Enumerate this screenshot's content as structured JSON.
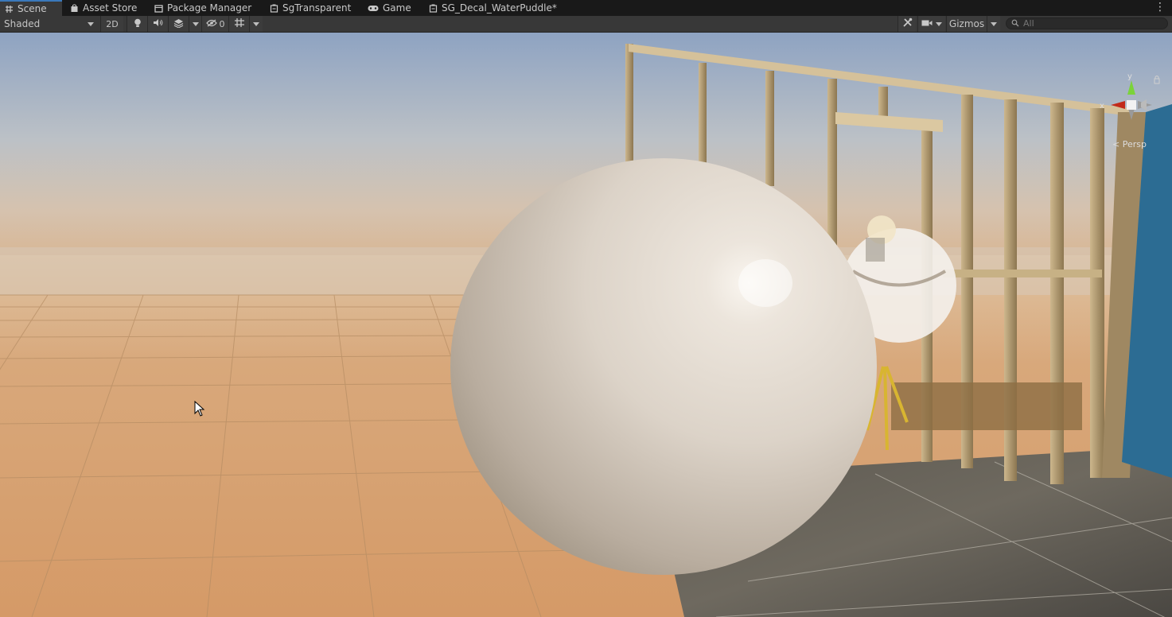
{
  "tabs": [
    {
      "label": "Scene",
      "icon": "scene-grid-icon",
      "active": true
    },
    {
      "label": "Asset Store",
      "icon": "store-bag-icon"
    },
    {
      "label": "Package Manager",
      "icon": "package-box-icon"
    },
    {
      "label": "SgTransparent",
      "icon": "shader-graph-icon"
    },
    {
      "label": "Game",
      "icon": "gamepad-icon"
    },
    {
      "label": "SG_Decal_WaterPuddle*",
      "icon": "shader-graph-icon"
    }
  ],
  "toolbar": {
    "shading_mode": "Shaded",
    "toggle_2d": "2D",
    "hidden_count": "0",
    "gizmos_label": "Gizmos",
    "search_placeholder": "All"
  },
  "viewport": {
    "gizmo_x_label": "x",
    "gizmo_y_label": "y",
    "projection_label": "< Persp"
  },
  "colors": {
    "accent": "#3a79bb",
    "axis_x": "#c22a1a",
    "axis_y": "#7bd33a"
  }
}
